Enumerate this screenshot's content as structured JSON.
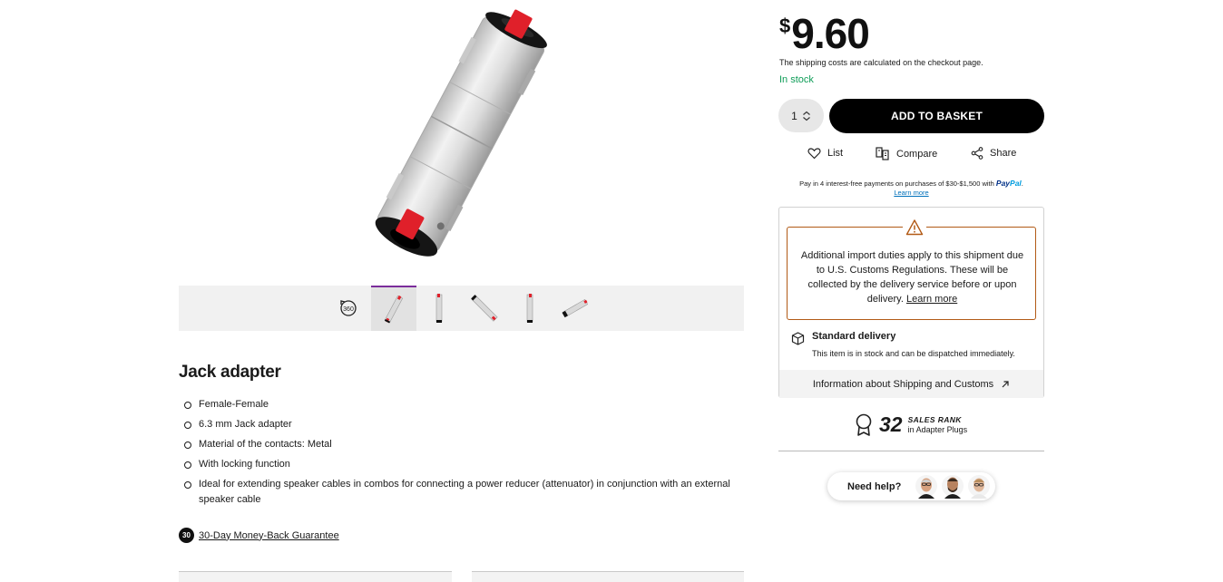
{
  "product": {
    "title": "Jack adapter",
    "features": [
      "Female-Female",
      "6.3 mm Jack adapter",
      "Material of the contacts: Metal",
      "With locking function",
      "Ideal for extending speaker cables in combos for connecting a power reducer (attenuator) in conjunction with an external speaker cable"
    ],
    "guarantee": {
      "badge": "30",
      "text": "30-Day Money-Back Guarantee"
    }
  },
  "gallery": {
    "thumbnails": [
      {
        "name": "360-view-icon"
      },
      {
        "name": "image-1",
        "active": true
      },
      {
        "name": "image-2"
      },
      {
        "name": "image-3"
      },
      {
        "name": "image-4"
      },
      {
        "name": "image-5"
      }
    ]
  },
  "buybox": {
    "currency": "$",
    "price": "9.60",
    "shipping_note": "The shipping costs are calculated on the checkout page.",
    "stock": "In stock",
    "quantity": "1",
    "add_label": "ADD TO BASKET",
    "actions": {
      "list": "List",
      "compare": "Compare",
      "share": "Share"
    },
    "paypal": {
      "text": "Pay in 4 interest-free payments on purchases of $30-$1,500 with",
      "logo_1": "Pay",
      "logo_2": "Pal",
      "logo_dot": ".",
      "learn": "Learn more"
    }
  },
  "delivery": {
    "warning_text": "Additional import duties apply to this shipment due to U.S. Customs Regulations. These will be collected by the delivery service before or upon delivery.",
    "warning_link": "Learn more",
    "standard_title": "Standard delivery",
    "standard_sub": "This item is in stock and can be dispatched immediately.",
    "info_link": "Information about Shipping and Customs"
  },
  "rank": {
    "number": "32",
    "label": "SALES RANK",
    "category": "in Adapter Plugs"
  },
  "help": {
    "label": "Need help?"
  },
  "colors": {
    "accent_red": "#e0202a",
    "stock_green": "#0f9d58",
    "warning_border": "#b25a16",
    "button_black": "#000000",
    "paypal_dark": "#003087",
    "paypal_light": "#009cde"
  }
}
